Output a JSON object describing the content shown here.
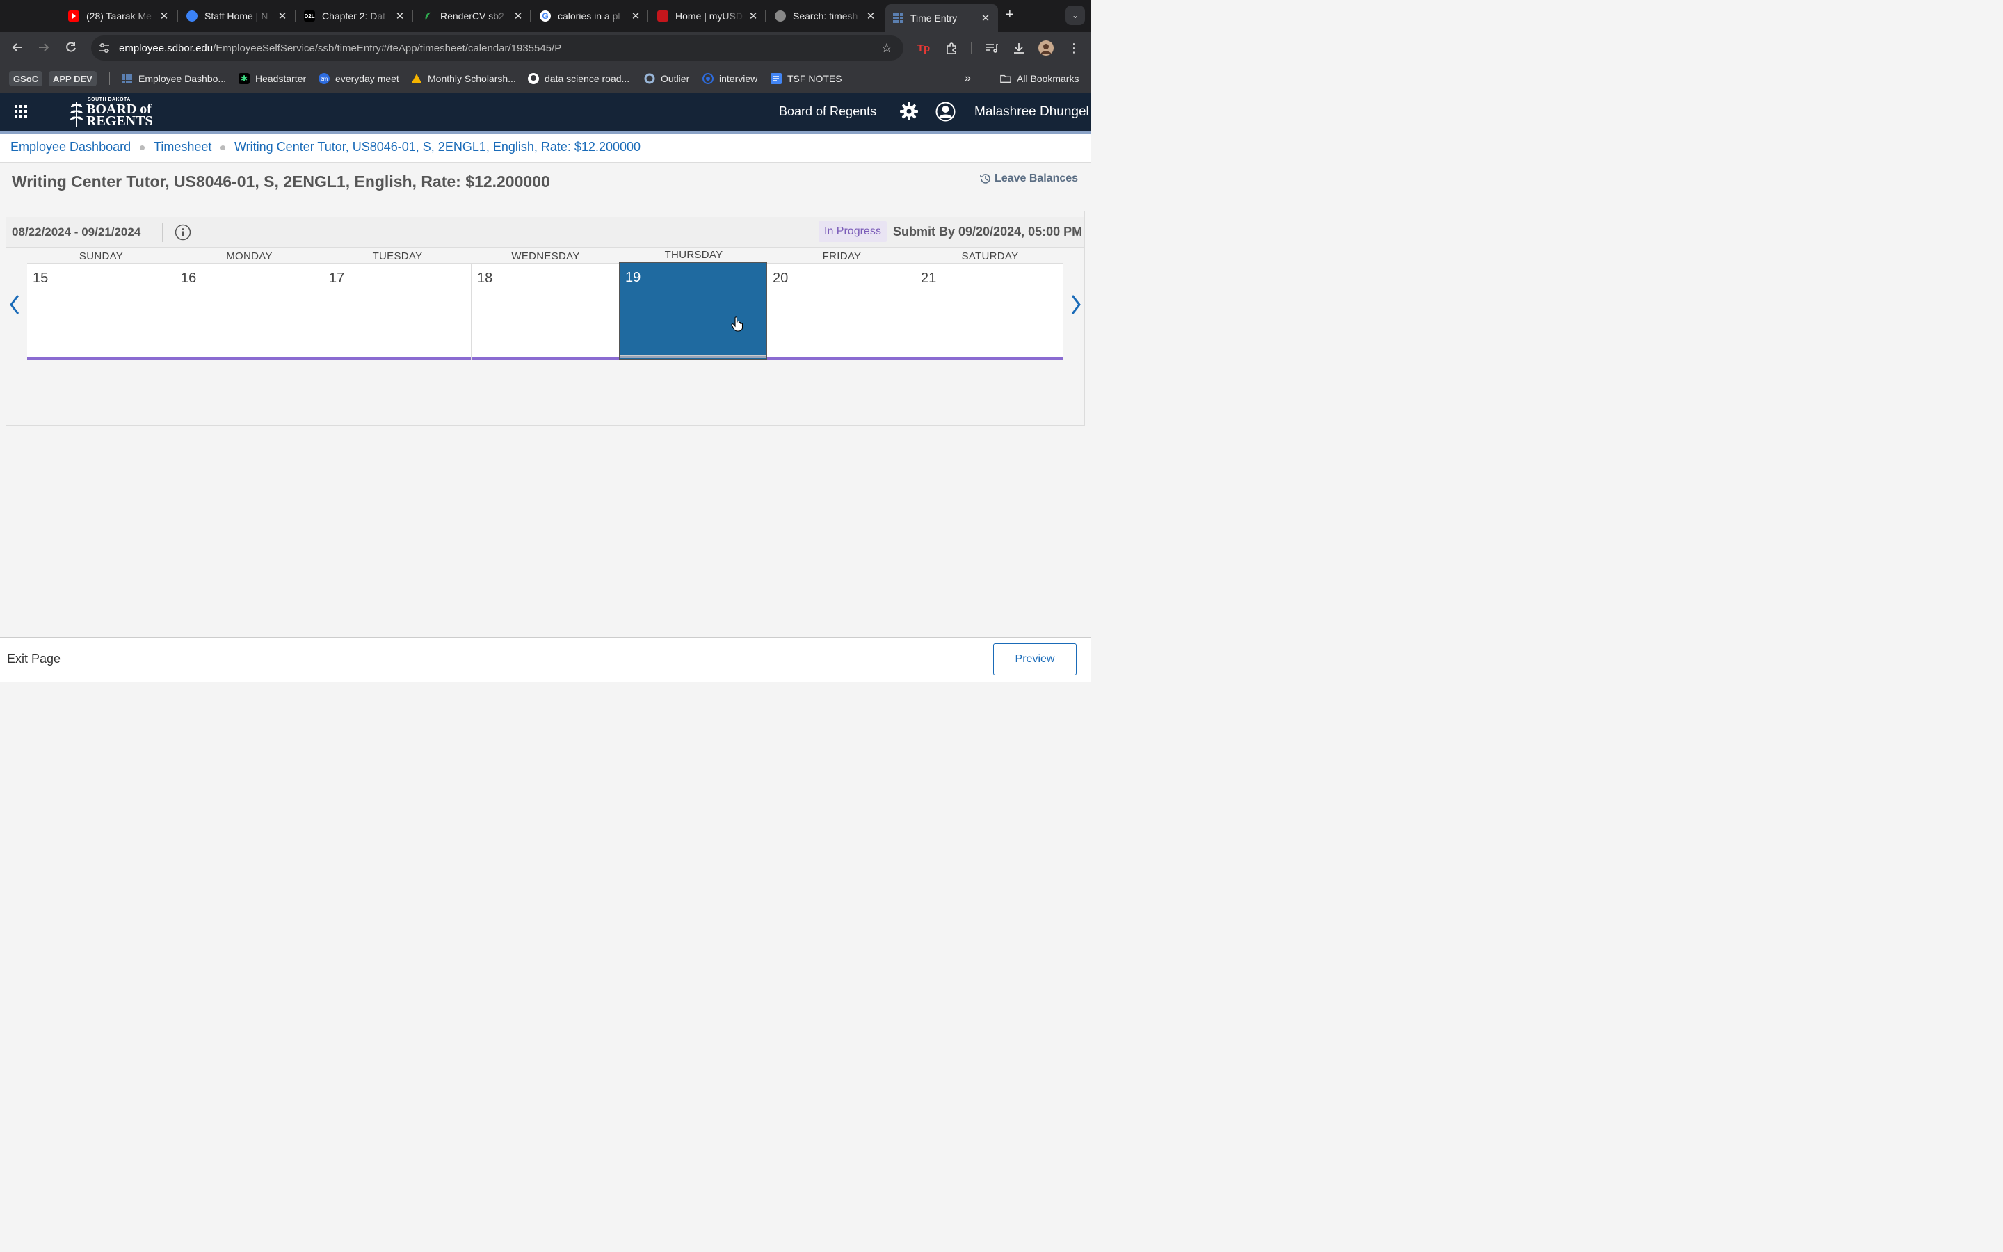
{
  "browser": {
    "tabs": [
      {
        "title": "(28) Taarak Me",
        "favicon_color": "#ff0000",
        "icon": "youtube-icon"
      },
      {
        "title": "Staff Home | N",
        "favicon_color": "#3b82f6",
        "icon": "globe-icon"
      },
      {
        "title": "Chapter 2: Dat",
        "favicon_color": "#000000",
        "icon": "d2l-icon"
      },
      {
        "title": "RenderCV sb2",
        "favicon_color": "#2fa84f",
        "icon": "rendercv-icon"
      },
      {
        "title": "calories in a pl",
        "favicon_color": "#ffffff",
        "icon": "google-icon"
      },
      {
        "title": "Home | myUSD",
        "favicon_color": "#c4161c",
        "icon": "usd-icon"
      },
      {
        "title": "Search: timesh",
        "favicon_color": "#aaaaaa",
        "icon": "globe-icon"
      },
      {
        "title": "Time Entry",
        "favicon_color": "#5b7fb0",
        "icon": "grid-favicon-icon"
      }
    ],
    "url_host": "employee.sdbor.edu",
    "url_path": "/EmployeeSelfService/ssb/timeEntry#/teApp/timesheet/calendar/1935545/P",
    "bookmarks": {
      "chips": [
        "GSoC",
        "APP DEV"
      ],
      "items": [
        {
          "label": "Employee Dashbo...",
          "icon": "grid-bookmark-icon"
        },
        {
          "label": "Headstarter",
          "icon": "headstarter-icon"
        },
        {
          "label": "everyday meet",
          "icon": "zoom-icon"
        },
        {
          "label": "Monthly Scholarsh...",
          "icon": "scholarship-icon"
        },
        {
          "label": "data science road...",
          "icon": "github-icon"
        },
        {
          "label": "Outlier",
          "icon": "outlier-icon"
        },
        {
          "label": "interview",
          "icon": "interview-icon"
        },
        {
          "label": "TSF NOTES",
          "icon": "docs-icon"
        }
      ],
      "all_bookmarks": "All Bookmarks"
    }
  },
  "header": {
    "logo_line1": "SOUTH DAKOTA",
    "logo_line2": "BOARD of",
    "logo_line3": "REGENTS",
    "institution": "Board of Regents",
    "user_name": "Malashree Dhungel"
  },
  "breadcrumb": {
    "items": [
      "Employee Dashboard",
      "Timesheet"
    ],
    "current": "Writing Center Tutor, US8046-01, S, 2ENGL1, English, Rate: $12.200000"
  },
  "page": {
    "title": "Writing Center Tutor, US8046-01, S, 2ENGL1, English, Rate: $12.200000",
    "leave_balances": "Leave Balances"
  },
  "timesheet": {
    "period": "08/22/2024 - 09/21/2024",
    "status": "In Progress",
    "submit_by": "Submit By 09/20/2024, 05:00 PM",
    "days": [
      {
        "name": "SUNDAY",
        "num": "15"
      },
      {
        "name": "MONDAY",
        "num": "16"
      },
      {
        "name": "TUESDAY",
        "num": "17"
      },
      {
        "name": "WEDNESDAY",
        "num": "18"
      },
      {
        "name": "THURSDAY",
        "num": "19",
        "selected": true
      },
      {
        "name": "FRIDAY",
        "num": "20"
      },
      {
        "name": "SATURDAY",
        "num": "21"
      }
    ]
  },
  "footer": {
    "exit": "Exit Page",
    "preview": "Preview"
  },
  "colors": {
    "header_bg": "#152437",
    "link": "#1a6bb8",
    "selected_day": "#1f6aa0",
    "day_bar": "#8a6bd1",
    "status_text": "#7a5bb8"
  }
}
